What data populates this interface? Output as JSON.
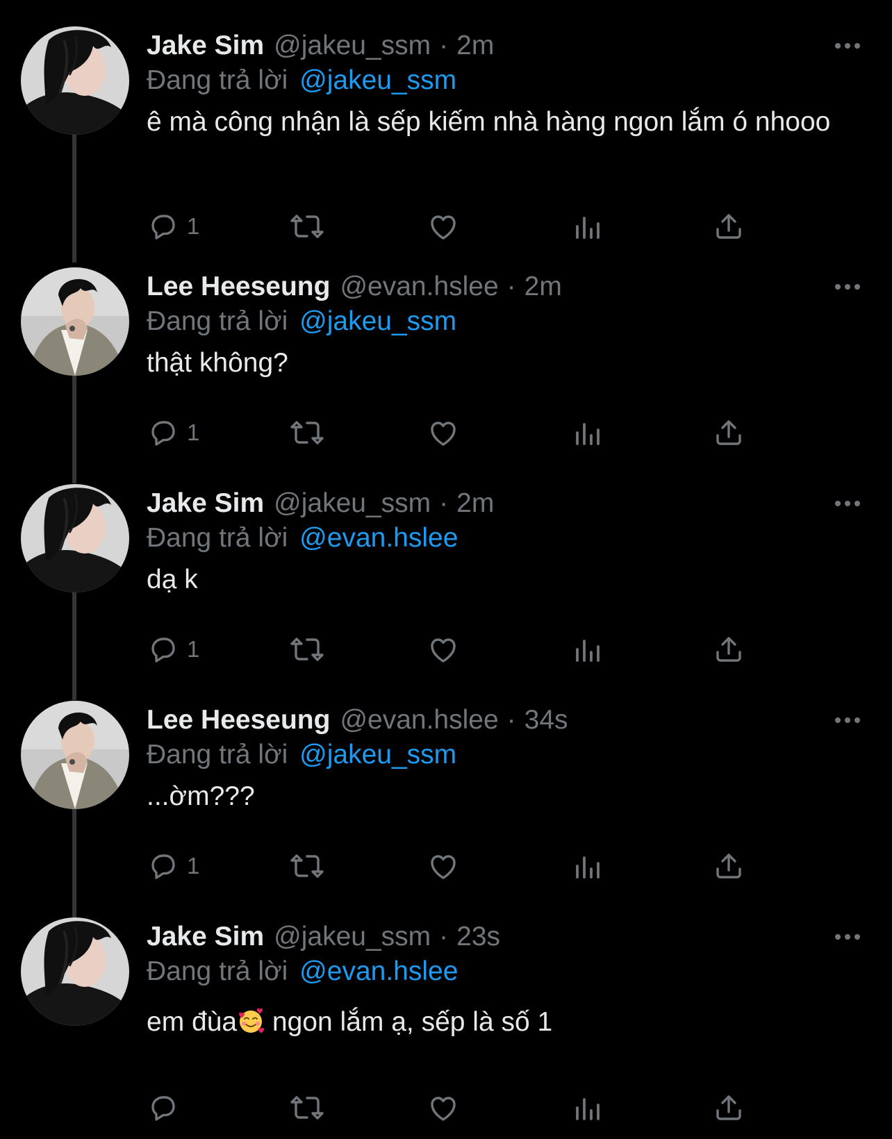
{
  "colors": {
    "background": "#000000",
    "primary_text": "#e7e9ea",
    "secondary_text": "#71767b",
    "accent": "#1d9bf0",
    "thread_line": "#333639"
  },
  "icons": {
    "reply": "reply-bubble-icon",
    "retweet": "retweet-arrows-icon",
    "like": "heart-icon",
    "views": "bar-chart-icon",
    "share": "share-upload-icon",
    "more": "more-horizontal-icon"
  },
  "tweets": [
    {
      "name": "Jake Sim",
      "handle": "@jakeu_ssm",
      "dot": "·",
      "time": "2m",
      "replying_label": "Đang trả lời",
      "replying_to": "@jakeu_ssm",
      "text": "ê mà công nhận là sếp kiếm nhà hàng ngon lắm ó nhooo",
      "reply_count": "1"
    },
    {
      "name": "Lee Heeseung",
      "handle": "@evan.hslee",
      "dot": "·",
      "time": "2m",
      "replying_label": "Đang trả lời",
      "replying_to": "@jakeu_ssm",
      "text": "thật không?",
      "reply_count": "1"
    },
    {
      "name": "Jake Sim",
      "handle": "@jakeu_ssm",
      "dot": "·",
      "time": "2m",
      "replying_label": "Đang trả lời",
      "replying_to": "@evan.hslee",
      "text": "dạ k",
      "reply_count": "1"
    },
    {
      "name": "Lee Heeseung",
      "handle": "@evan.hslee",
      "dot": "·",
      "time": "34s",
      "replying_label": "Đang trả lời",
      "replying_to": "@jakeu_ssm",
      "text": "...ờm???",
      "reply_count": "1"
    },
    {
      "name": "Jake Sim",
      "handle": "@jakeu_ssm",
      "dot": "·",
      "time": "23s",
      "replying_label": "Đang trả lời",
      "replying_to": "@evan.hslee",
      "text_before_emoji": "em đùa",
      "emoji": "smiling-face-with-hearts-emoji",
      "text_after_emoji": " ngon lắm ạ, sếp là số 1",
      "reply_count": ""
    }
  ]
}
